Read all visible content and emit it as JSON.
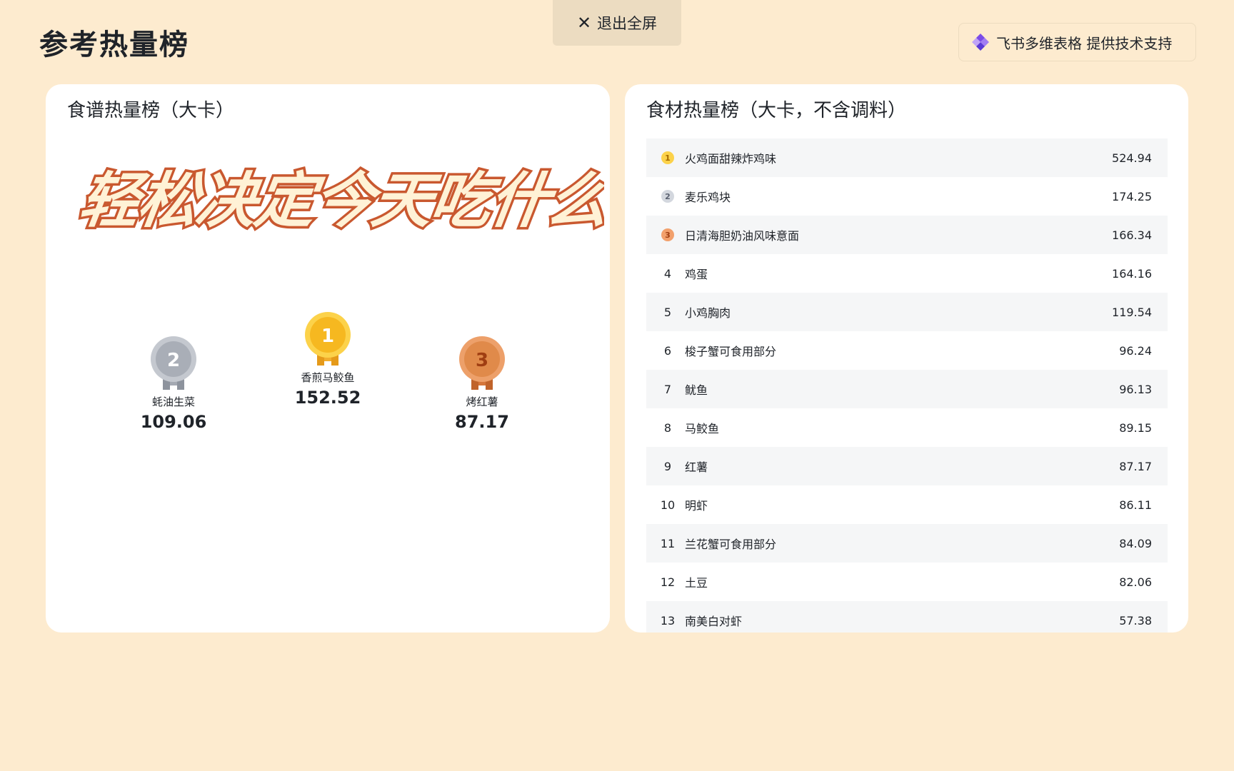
{
  "page": {
    "title": "参考热量榜",
    "exit_fullscreen": "退出全屏",
    "powered_by": "飞书多维表格 提供技术支持"
  },
  "recipe_card": {
    "title": "食谱热量榜（大卡）",
    "banner_text": "轻松决定今天吃什么",
    "podium": [
      {
        "rank": "1",
        "name": "香煎马鲛鱼",
        "value": "152.52",
        "medal": "gold"
      },
      {
        "rank": "2",
        "name": "蚝油生菜",
        "value": "109.06",
        "medal": "silver"
      },
      {
        "rank": "3",
        "name": "烤红薯",
        "value": "87.17",
        "medal": "bronze"
      }
    ]
  },
  "ingredient_card": {
    "title": "食材热量榜（大卡，不含调料）",
    "rows": [
      {
        "rank": "1",
        "name": "火鸡面甜辣炸鸡味",
        "value": "524.94"
      },
      {
        "rank": "2",
        "name": "麦乐鸡块",
        "value": "174.25"
      },
      {
        "rank": "3",
        "name": "日清海胆奶油风味意面",
        "value": "166.34"
      },
      {
        "rank": "4",
        "name": "鸡蛋",
        "value": "164.16"
      },
      {
        "rank": "5",
        "name": "小鸡胸肉",
        "value": "119.54"
      },
      {
        "rank": "6",
        "name": "梭子蟹可食用部分",
        "value": "96.24"
      },
      {
        "rank": "7",
        "name": "鱿鱼",
        "value": "96.13"
      },
      {
        "rank": "8",
        "name": "马鲛鱼",
        "value": "89.15"
      },
      {
        "rank": "9",
        "name": "红薯",
        "value": "87.17"
      },
      {
        "rank": "10",
        "name": "明虾",
        "value": "86.11"
      },
      {
        "rank": "11",
        "name": "兰花蟹可食用部分",
        "value": "84.09"
      },
      {
        "rank": "12",
        "name": "土豆",
        "value": "82.06"
      },
      {
        "rank": "13",
        "name": "南美白对虾",
        "value": "57.38"
      }
    ]
  },
  "colors": {
    "background": "#fdebcf",
    "gold": "#f6b820",
    "silver": "#b8bdc6",
    "bronze": "#e08a4a",
    "banner_fill": "#fff2d6",
    "banner_stroke": "#c9582f"
  }
}
